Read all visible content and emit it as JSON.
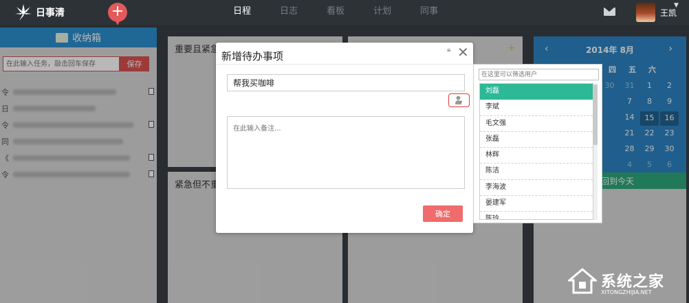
{
  "app": {
    "name": "日事清",
    "brand_color": "#2c8fcf"
  },
  "nav": {
    "items": [
      "日程",
      "日志",
      "看板",
      "计划",
      "同事"
    ],
    "active": 0
  },
  "user": {
    "name": "王凯"
  },
  "inbox": {
    "title": "收纳箱",
    "input_placeholder": "在此输入任务，敲击回车保存",
    "save_label": "保存",
    "row_prefixes": [
      "令",
      "日",
      "令",
      "同",
      "《",
      "令"
    ]
  },
  "quadrants": {
    "q1_title": "重要且紧急",
    "q3_title": "紧急但不重要"
  },
  "calendar": {
    "title": "2014年 8月",
    "weekdays": [
      "四",
      "五",
      "六"
    ],
    "visible_days": [
      [
        "30",
        "31",
        "1",
        "2"
      ],
      [
        "",
        "7",
        "8",
        "9"
      ],
      [
        "",
        "14",
        "15",
        "16"
      ],
      [
        "",
        "21",
        "22",
        "23"
      ],
      [
        "",
        "28",
        "29",
        "30"
      ],
      [
        "",
        "4",
        "5",
        "6"
      ]
    ],
    "today_label": "回到今天"
  },
  "modal": {
    "title": "新增待办事项",
    "todo_value": "帮我买咖啡",
    "note_placeholder": "在此输入备注...",
    "ok_label": "确定"
  },
  "picker": {
    "filter_placeholder": "在这里可以筛选用户",
    "users": [
      "刘磊",
      "李斌",
      "毛文强",
      "张磊",
      "林辉",
      "陈洁",
      "李海波",
      "晏建军",
      "陈玲"
    ],
    "selected": 0,
    "selected_color": "#2db896"
  },
  "watermark": {
    "text": "系统之家",
    "url": "XITONGZHIJIA.NET"
  }
}
